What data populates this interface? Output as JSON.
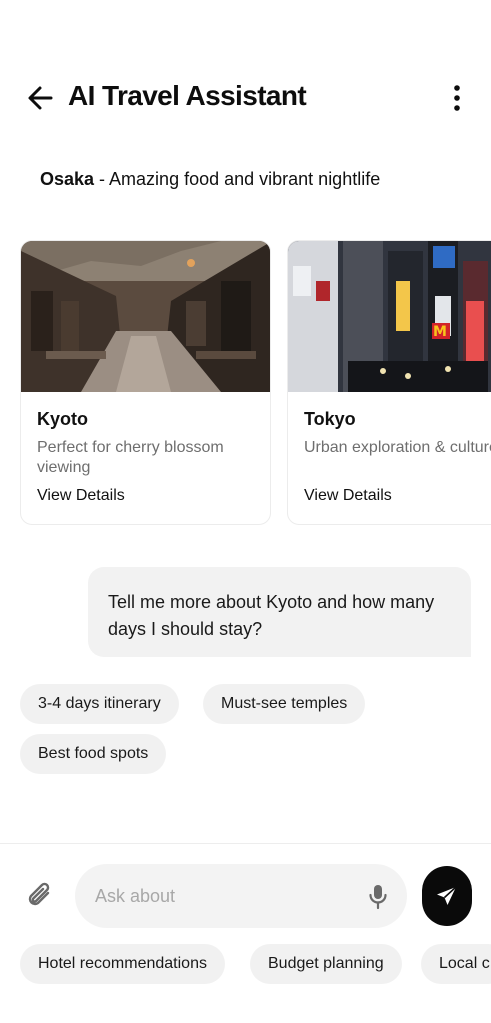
{
  "header": {
    "title": "AI Travel Assistant",
    "back_icon": "arrow-left-icon",
    "menu_icon": "more-vertical-icon"
  },
  "bot_message": {
    "highlight": "Osaka",
    "text": " - Amazing food and vibrant nightlife"
  },
  "cards": [
    {
      "title": "Kyoto",
      "description": "Perfect for cherry blossom viewing",
      "link": "View Details"
    },
    {
      "title": "Tokyo",
      "description": "Urban exploration & culture",
      "link": "View Details"
    }
  ],
  "user_message": "Tell me more about Kyoto and how many days I should stay?",
  "suggestions": [
    "3-4 days itinerary",
    "Must-see temples",
    "Best food spots"
  ],
  "composer": {
    "placeholder": "Ask about",
    "attach_icon": "paperclip-icon",
    "mic_icon": "microphone-icon",
    "send_icon": "send-icon"
  },
  "quick_actions": [
    "Hotel recommendations",
    "Budget planning",
    "Local c"
  ],
  "colors": {
    "accent": "#0a0a0a",
    "bubble": "#f2f2f2",
    "chip": "#f1f1f1",
    "muted_text": "#6e6e6e"
  }
}
